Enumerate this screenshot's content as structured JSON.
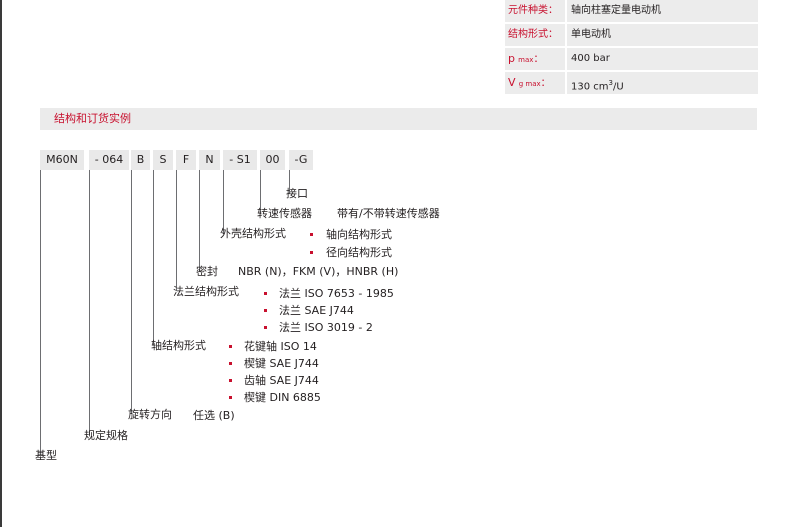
{
  "spec_table": {
    "rows": [
      {
        "label": "元件种类：",
        "value": "轴向柱塞定量电动机"
      },
      {
        "label": "结构形式：",
        "value": "单电动机"
      },
      {
        "label_symbol": "p",
        "label_sub": "max",
        "label_colon": "：",
        "value": "400 bar"
      },
      {
        "label_symbol": "V",
        "label_sub": "g max",
        "label_colon": "：",
        "value_main": "130 cm",
        "value_sup": "3",
        "value_tail": "/U"
      }
    ]
  },
  "section": {
    "title": "结构和订货实例"
  },
  "order_code": [
    "M60N",
    "- 064",
    "B",
    "S",
    "F",
    "N",
    "- S1",
    "00",
    "-G"
  ],
  "labels": {
    "port": "接口",
    "speed_sensor": "转速传感器",
    "speed_sensor_option": "带有/不带转速传感器",
    "housing": "外壳结构形式",
    "housing_options": [
      "轴向结构形式",
      "径向结构形式"
    ],
    "seal": "密封",
    "seal_options": "NBR (N)，FKM (V)，HNBR (H)",
    "flange": "法兰结构形式",
    "flange_options": [
      "法兰 ISO 7653 - 1985",
      "法兰 SAE J744",
      "法兰 ISO 3019 - 2"
    ],
    "shaft": "轴结构形式",
    "shaft_options": [
      "花键轴 ISO 14",
      "楔键 SAE J744",
      "齿轴 SAE J744",
      "楔键 DIN 6885"
    ],
    "rotation": "旋转方向",
    "rotation_option": "任选 (B)",
    "size": "规定规格",
    "base": "基型"
  },
  "colors": {
    "accent": "#c8102e",
    "band": "#ebebeb",
    "text": "#231f20"
  }
}
